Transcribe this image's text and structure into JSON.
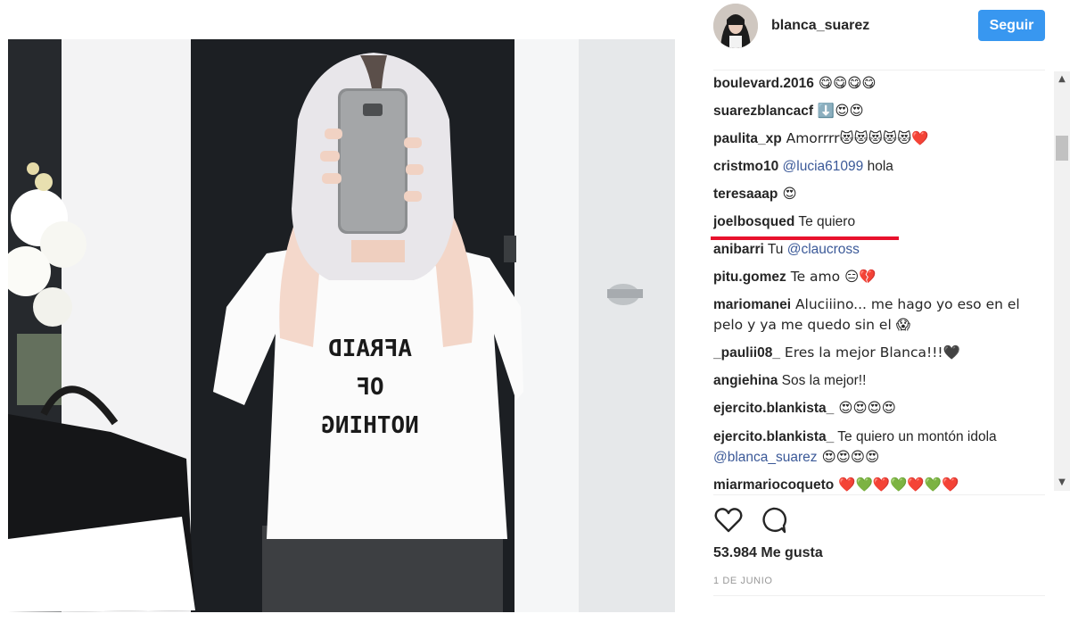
{
  "post": {
    "username": "blanca_suarez",
    "follow_label": "Seguir",
    "likes": "53.984 Me gusta",
    "date": "1 DE JUNIO",
    "shirt_text": [
      "AFRAID",
      "OF",
      "NOTHING"
    ]
  },
  "comments": [
    {
      "user": "boulevard.2016",
      "text": " 😋😋😋😋"
    },
    {
      "user": "suarezblancacf",
      "text": " ⬇️😍😍"
    },
    {
      "user": "paulita_xp",
      "text": " Amorrrr😻😻😻😻😻❤️"
    },
    {
      "user": "cristmo10",
      "mention": " @lucia61099",
      "text": " hola"
    },
    {
      "user": "teresaaap",
      "text": " 😍"
    },
    {
      "user": "joelbosqued",
      "text": " Te quiero"
    },
    {
      "user": "anibarri",
      "text": " Tu",
      "mention": " @claucross"
    },
    {
      "user": "pitu.gomez",
      "text": " Te amo 😑💔"
    },
    {
      "user": "mariomanei",
      "text": " Aluciiino... me hago yo eso en el pelo y ya me quedo sin el 😱"
    },
    {
      "user": "_pauliі08_",
      "text": " Eres la mejor Blanca!!!🖤"
    },
    {
      "user": "angiehina",
      "text": " Sos la mejor!!"
    },
    {
      "user": "ejercito.blankista_",
      "text": " 😍😍😍😍"
    },
    {
      "user": "ejercito.blankista_",
      "text": " Te quiero un montón idola",
      "mention": " @blanca_suarez",
      "tail": " 😍😍😍😍"
    },
    {
      "user": "miarmarioсoqueto",
      "text": " ❤️💚❤️💚❤️💚❤️"
    }
  ],
  "icons": {
    "like": "heart-outline-icon",
    "comment": "comment-bubble-icon"
  }
}
